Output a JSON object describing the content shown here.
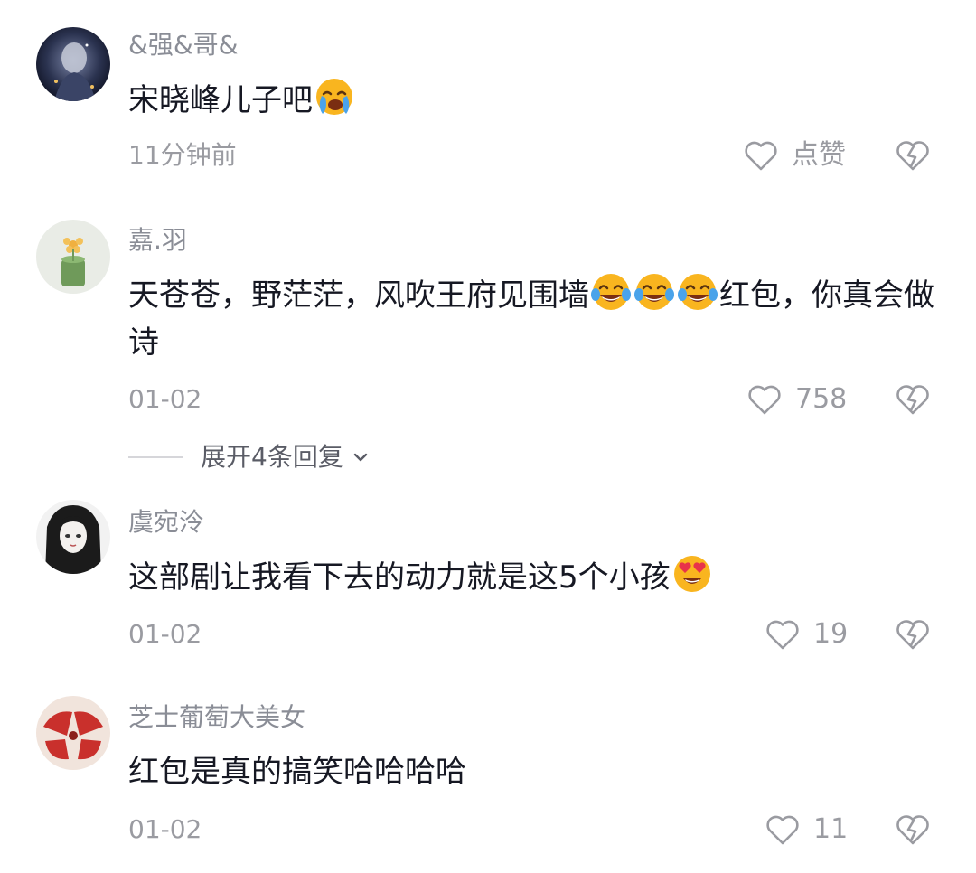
{
  "comments": [
    {
      "username": "&强&哥&",
      "text_before": "宋晓峰儿子吧",
      "emojis": [
        "crying-face-emoji"
      ],
      "time": "11分钟前",
      "like_label": "点赞"
    },
    {
      "username": "嘉.羽",
      "text_before": "天苍苍，野茫茫，风吹王府见围墙",
      "emojis": [
        "tears-of-joy-emoji",
        "tears-of-joy-emoji",
        "tears-of-joy-emoji"
      ],
      "text_after": "红包，你真会做诗",
      "time": "01-02",
      "like_label": "758",
      "expand_replies": "展开4条回复"
    },
    {
      "username": "虞宛泠",
      "text_before": "这部剧让我看下去的动力就是这5个小孩",
      "emojis": [
        "heart-eyes-emoji"
      ],
      "time": "01-02",
      "like_label": "19"
    },
    {
      "username": "芝士葡萄大美女",
      "text_before": "红包是真的搞笑哈哈哈哈",
      "time": "01-02",
      "like_label": "11"
    }
  ],
  "colors": {
    "text": "#161823",
    "username": "#8a8d96",
    "meta": "#9a9ba1",
    "emoji_yellow": "#f9b51f",
    "tear_blue": "#4aa3ea",
    "heart_red": "#e8334a"
  }
}
